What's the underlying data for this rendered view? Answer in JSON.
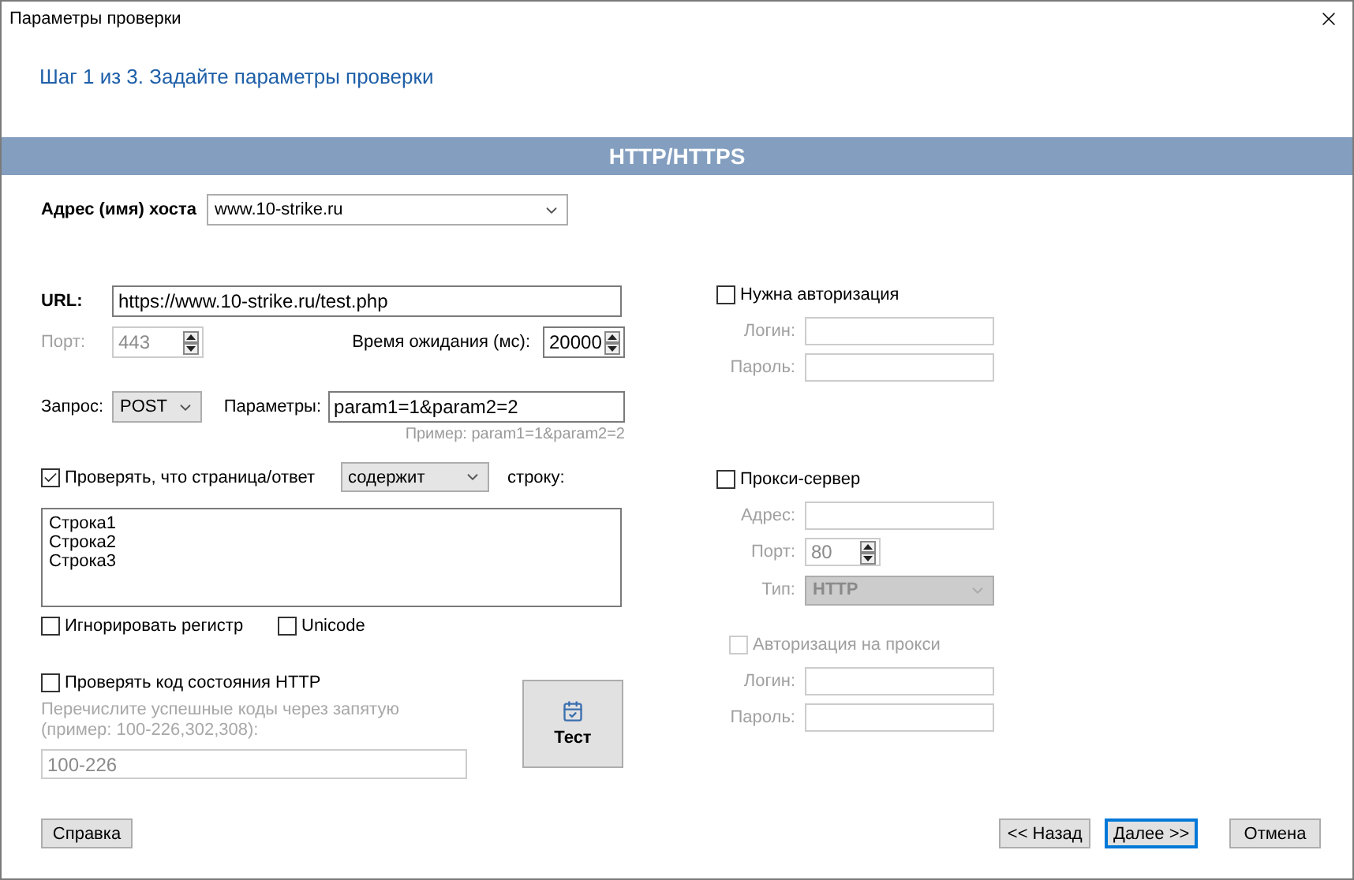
{
  "window": {
    "title": "Параметры проверки"
  },
  "step_title": "Шаг 1 из 3. Задайте параметры проверки",
  "banner": "HTTP/HTTPS",
  "host": {
    "label": "Адрес (имя) хоста",
    "value": "www.10-strike.ru"
  },
  "url": {
    "label": "URL:",
    "value": "https://www.10-strike.ru/test.php"
  },
  "port": {
    "label": "Порт:",
    "value": "443",
    "disabled": true
  },
  "timeout": {
    "label": "Время ожидания (мс):",
    "value": "20000",
    "disabled": false
  },
  "request": {
    "label": "Запрос:",
    "value": "POST"
  },
  "params": {
    "label": "Параметры:",
    "value": "param1=1&param2=2",
    "hint": "Пример: param1=1&param2=2"
  },
  "content_check": {
    "label": "Проверять, что страница/ответ",
    "checked": true,
    "mode": "содержит",
    "suffix": "строку:",
    "lines": [
      "Строка1",
      "Строка2",
      "Строка3"
    ]
  },
  "options": [
    {
      "label": "Игнорировать регистр",
      "checked": false
    },
    {
      "label": "Unicode",
      "checked": false
    }
  ],
  "status_check": {
    "label": "Проверять код состояния HTTP",
    "checked": false,
    "hint": "Перечислите успешные коды через запятую\n(пример: 100-226,302,308):",
    "value": "100-226"
  },
  "test_button": {
    "label": "Тест"
  },
  "auth": {
    "label": "Нужна авторизация",
    "checked": false,
    "fields": [
      {
        "label": "Логин:"
      },
      {
        "label": "Пароль:"
      }
    ]
  },
  "proxy": {
    "label": "Прокси-сервер",
    "checked": false,
    "address_label": "Адрес:",
    "port": {
      "label": "Порт:",
      "value": "80"
    },
    "type": {
      "label": "Тип:",
      "value": "HTTP"
    },
    "auth": {
      "label": "Авторизация на прокси",
      "checked": false
    },
    "fields": [
      {
        "label": "Логин:"
      },
      {
        "label": "Пароль:"
      }
    ]
  },
  "buttons": [
    {
      "label": "Справка",
      "focused": false
    },
    {
      "label": "<< Назад",
      "focused": false
    },
    {
      "label": "Далее >>",
      "focused": true
    },
    {
      "label": "Отмена",
      "focused": false
    }
  ]
}
